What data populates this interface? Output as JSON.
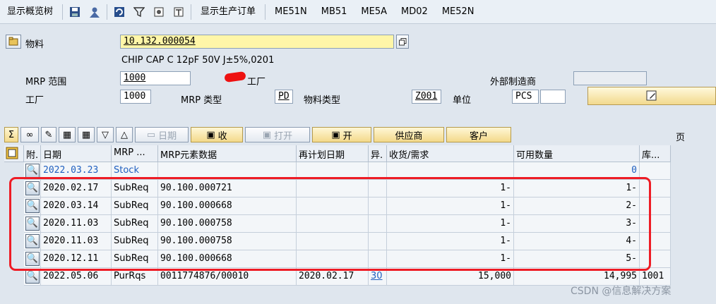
{
  "toolbar": {
    "show_tree": "显示概览树",
    "show_prod_orders": "显示生产订单",
    "me51n": "ME51N",
    "mb51": "MB51",
    "me5a": "ME5A",
    "md02": "MD02",
    "me52n": "ME52N"
  },
  "header": {
    "material_label": "物料",
    "material_value": "10.132.000054",
    "material_desc": "CHIP CAP C 12pF 50V J±5%,0201",
    "mrp_area_label": "MRP 范围",
    "mrp_area_value": "1000",
    "mrp_area_suffix": "工厂",
    "ext_mfr_label": "外部制造商",
    "plant_label": "工厂",
    "plant_value": "1000",
    "mrp_type_label": "MRP 类型",
    "mrp_type_value": "PD",
    "mat_type_label": "物料类型",
    "mat_type_value": "Z001",
    "unit_label": "单位",
    "unit_value": "PCS"
  },
  "actions": {
    "date_label": "日期",
    "receipt_label": "收",
    "open_label": "打开",
    "open2_label": "开",
    "vendor_label": "供应商",
    "customer_label": "客户",
    "page_label": "页"
  },
  "columns": [
    "附.",
    "日期",
    "MRP ...",
    "MRP元素数据",
    "再计划日期",
    "异.",
    "收货/需求",
    "可用数量",
    "库..."
  ],
  "rows": [
    {
      "date": "2022.03.23",
      "mrp": "Stock",
      "data": "",
      "resched": "",
      "exc": "",
      "qty": "",
      "avail": "0",
      "stor": ""
    },
    {
      "date": "2020.02.17",
      "mrp": "SubReq",
      "data": "90.100.000721",
      "resched": "",
      "exc": "",
      "qty": "1-",
      "avail": "1-",
      "stor": ""
    },
    {
      "date": "2020.03.14",
      "mrp": "SubReq",
      "data": "90.100.000668",
      "resched": "",
      "exc": "",
      "qty": "1-",
      "avail": "2-",
      "stor": ""
    },
    {
      "date": "2020.11.03",
      "mrp": "SubReq",
      "data": "90.100.000758",
      "resched": "",
      "exc": "",
      "qty": "1-",
      "avail": "3-",
      "stor": ""
    },
    {
      "date": "2020.11.03",
      "mrp": "SubReq",
      "data": "90.100.000758",
      "resched": "",
      "exc": "",
      "qty": "1-",
      "avail": "4-",
      "stor": ""
    },
    {
      "date": "2020.12.11",
      "mrp": "SubReq",
      "data": "90.100.000668",
      "resched": "",
      "exc": "",
      "qty": "1-",
      "avail": "5-",
      "stor": ""
    },
    {
      "date": "2022.05.06",
      "mrp": "PurRqs",
      "data": "0011774876/00010",
      "resched": "2020.02.17",
      "exc": "30",
      "qty": "15,000",
      "avail": "14,995",
      "stor": "1001"
    }
  ],
  "watermark": "CSDN @信息解决方案",
  "colors": {
    "highlight_border": "#ee1c25",
    "link_blue": "#1f5fbf",
    "field_yellow": "#fff6a8"
  }
}
